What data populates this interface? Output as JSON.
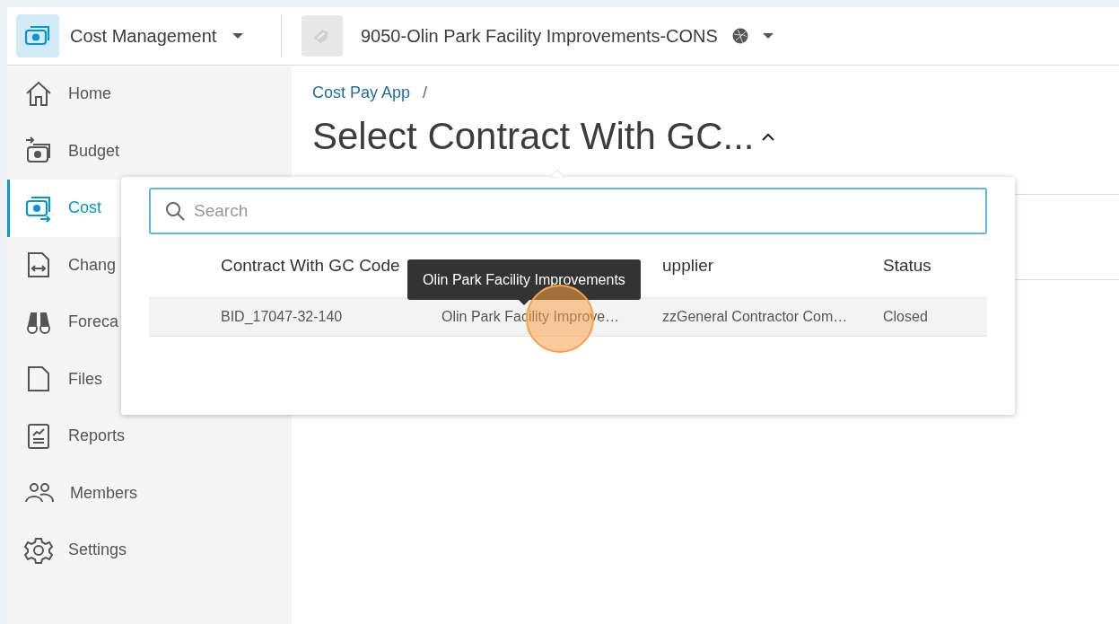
{
  "header": {
    "app_name": "Cost Management",
    "project_name": "9050-Olin Park Facility Improvements-CONS"
  },
  "sidebar": {
    "items": [
      {
        "label": "Home",
        "selected": false
      },
      {
        "label": "Budget",
        "selected": false
      },
      {
        "label": "Cost",
        "selected": true
      },
      {
        "label": "Chang",
        "selected": false
      },
      {
        "label": "Foreca",
        "selected": false
      },
      {
        "label": "Files",
        "selected": false
      },
      {
        "label": "Reports",
        "selected": false
      },
      {
        "label": "Members",
        "selected": false
      },
      {
        "label": "Settings",
        "selected": false
      }
    ]
  },
  "page": {
    "breadcrumb": "Cost Pay App",
    "breadcrumb_separator": "/",
    "title": "Select Contract With GC..."
  },
  "popup": {
    "search": {
      "placeholder": "Search"
    },
    "table": {
      "columns": {
        "column_1": "Contract With GC Code",
        "column_3": "upplier",
        "column_4": "Status"
      },
      "rows": [
        {
          "cells": [
            "BID_17047-32-140",
            "Olin Park Facility Improve…",
            "zzGeneral Contractor Com…",
            "Closed"
          ],
          "hovered": true
        }
      ]
    },
    "tooltip": {
      "text": "Olin Park Facility Improvements"
    }
  }
}
